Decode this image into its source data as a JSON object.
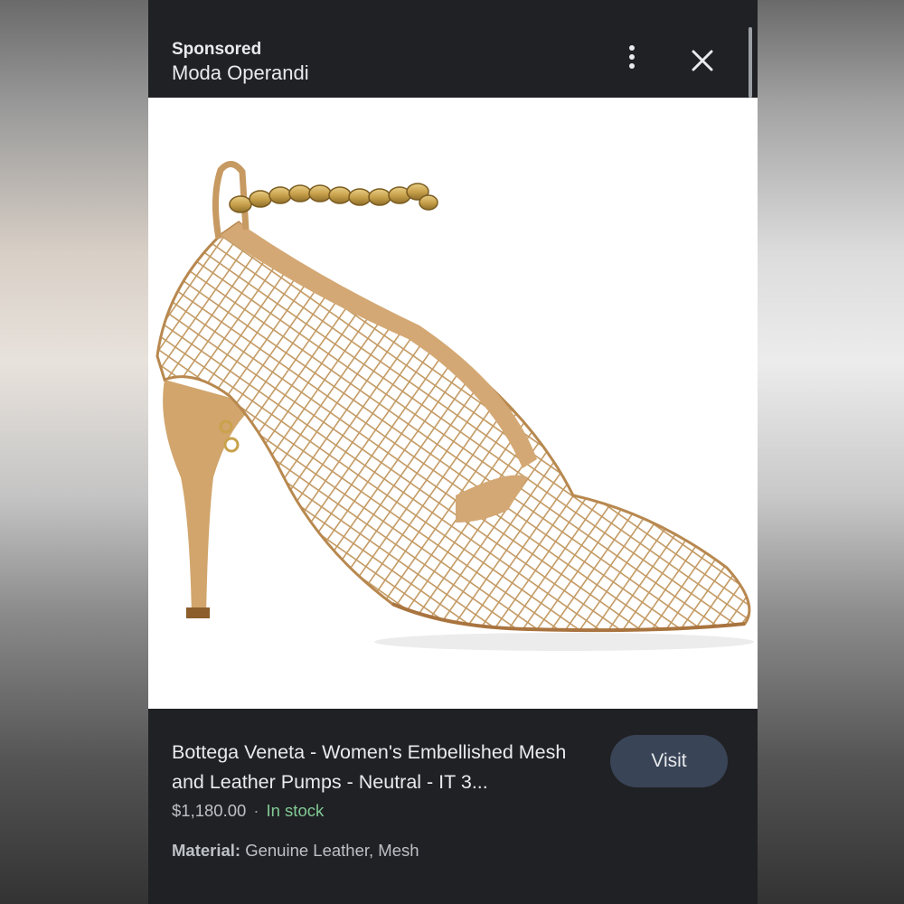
{
  "ad": {
    "sponsored_label": "Sponsored",
    "advertiser": "Moda Operandi"
  },
  "header_icons": {
    "menu": "more-vert-icon",
    "close": "close-icon"
  },
  "product": {
    "title": "Bottega Veneta - Women's Embellished Mesh and Leather Pumps - Neutral - IT 3...",
    "price": "$1,180.00",
    "separator": "·",
    "availability": "In stock",
    "material_label": "Material:",
    "material_value": "Genuine Leather, Mesh",
    "image": "shoe-image"
  },
  "actions": {
    "visit_label": "Visit"
  },
  "colors": {
    "panel_bg": "#202124",
    "text_primary": "#e8eaed",
    "text_secondary": "#bdc1c6",
    "in_stock": "#81c995",
    "visit_button_bg": "#394457"
  }
}
